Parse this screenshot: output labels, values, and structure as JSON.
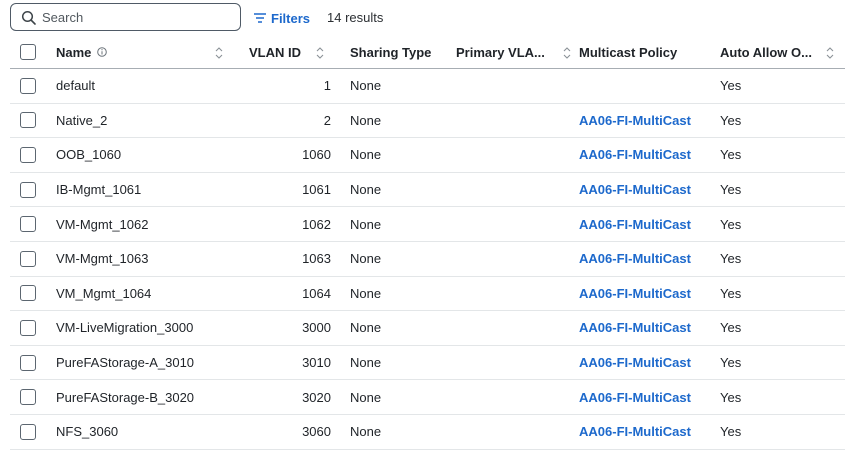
{
  "search": {
    "placeholder": "Search",
    "value": ""
  },
  "filters_label": "Filters",
  "results_text": "14 results",
  "columns": {
    "name": "Name",
    "vlan_id": "VLAN ID",
    "sharing_type": "Sharing Type",
    "primary_vlan": "Primary VLA...",
    "multicast_policy": "Multicast Policy",
    "auto_allow": "Auto Allow O..."
  },
  "rows": [
    {
      "name": "default",
      "vlan": "1",
      "sharing": "None",
      "primary": "",
      "multicast": "",
      "auto": "Yes"
    },
    {
      "name": "Native_2",
      "vlan": "2",
      "sharing": "None",
      "primary": "",
      "multicast": "AA06-FI-MultiCast",
      "auto": "Yes"
    },
    {
      "name": "OOB_1060",
      "vlan": "1060",
      "sharing": "None",
      "primary": "",
      "multicast": "AA06-FI-MultiCast",
      "auto": "Yes"
    },
    {
      "name": "IB-Mgmt_1061",
      "vlan": "1061",
      "sharing": "None",
      "primary": "",
      "multicast": "AA06-FI-MultiCast",
      "auto": "Yes"
    },
    {
      "name": "VM-Mgmt_1062",
      "vlan": "1062",
      "sharing": "None",
      "primary": "",
      "multicast": "AA06-FI-MultiCast",
      "auto": "Yes"
    },
    {
      "name": "VM-Mgmt_1063",
      "vlan": "1063",
      "sharing": "None",
      "primary": "",
      "multicast": "AA06-FI-MultiCast",
      "auto": "Yes"
    },
    {
      "name": "VM_Mgmt_1064",
      "vlan": "1064",
      "sharing": "None",
      "primary": "",
      "multicast": "AA06-FI-MultiCast",
      "auto": "Yes"
    },
    {
      "name": "VM-LiveMigration_3000",
      "vlan": "3000",
      "sharing": "None",
      "primary": "",
      "multicast": "AA06-FI-MultiCast",
      "auto": "Yes"
    },
    {
      "name": "PureFAStorage-A_3010",
      "vlan": "3010",
      "sharing": "None",
      "primary": "",
      "multicast": "AA06-FI-MultiCast",
      "auto": "Yes"
    },
    {
      "name": "PureFAStorage-B_3020",
      "vlan": "3020",
      "sharing": "None",
      "primary": "",
      "multicast": "AA06-FI-MultiCast",
      "auto": "Yes"
    },
    {
      "name": "NFS_3060",
      "vlan": "3060",
      "sharing": "None",
      "primary": "",
      "multicast": "AA06-FI-MultiCast",
      "auto": "Yes"
    }
  ],
  "colors": {
    "link": "#1d69cc",
    "border": "#4f5a66"
  }
}
